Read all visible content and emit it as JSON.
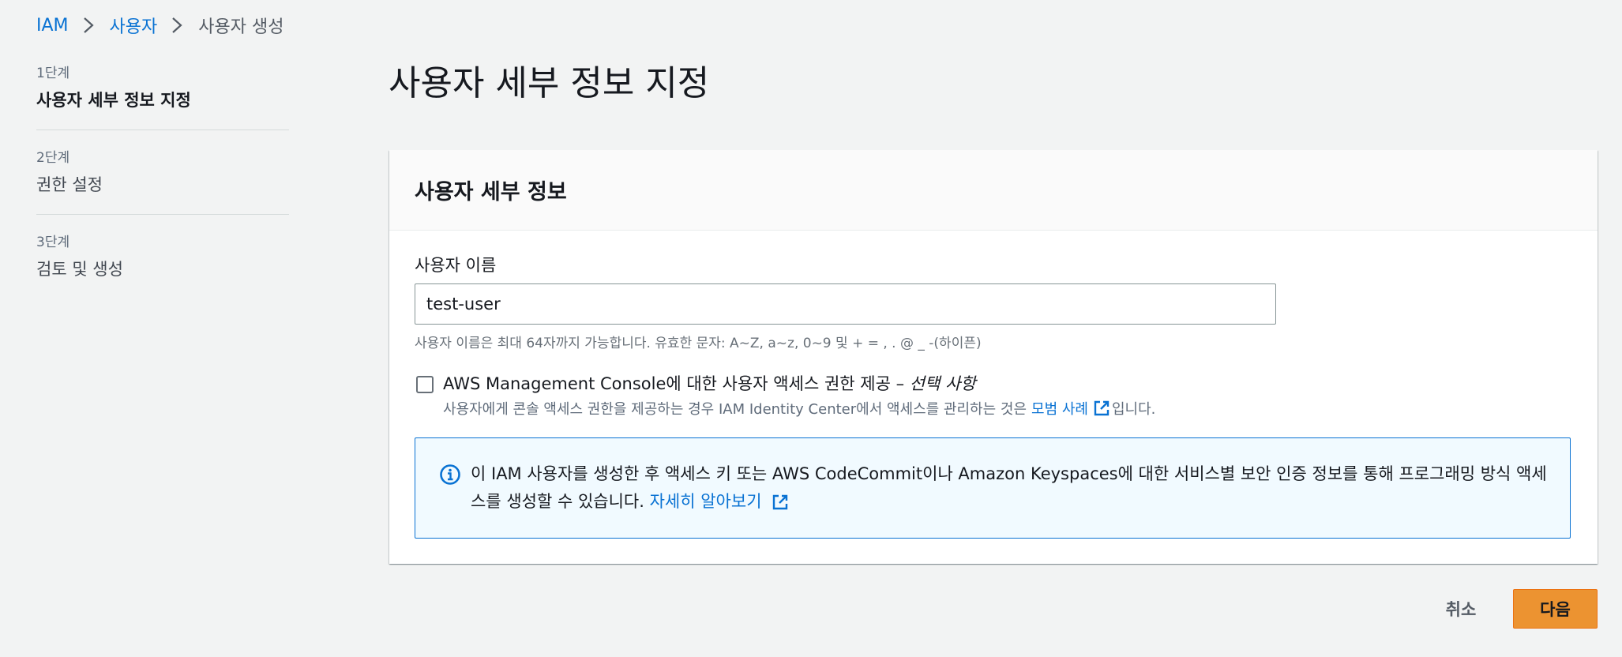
{
  "breadcrumb": {
    "items": [
      "IAM",
      "사용자"
    ],
    "current": "사용자 생성"
  },
  "steps": [
    {
      "number": "1단계",
      "title": "사용자 세부 정보 지정"
    },
    {
      "number": "2단계",
      "title": "권한 설정"
    },
    {
      "number": "3단계",
      "title": "검토 및 생성"
    }
  ],
  "page_title": "사용자 세부 정보 지정",
  "section": {
    "title": "사용자 세부 정보",
    "username": {
      "label": "사용자 이름",
      "value": "test-user",
      "hint": "사용자 이름은 최대 64자까지 가능합니다. 유효한 문자: A~Z, a~z, 0~9 및 + = , . @ _ -(하이픈)"
    },
    "console_access": {
      "label": "AWS Management Console에 대한 사용자 액세스 권한 제공 –",
      "optional": "선택 사항",
      "checked": false,
      "desc_before": "사용자에게 콘솔 액세스 권한을 제공하는 경우 IAM Identity Center에서 액세스를 관리하는 것은",
      "desc_link": "모범 사례",
      "desc_after": "입니다."
    },
    "info": {
      "text": "이 IAM 사용자를 생성한 후 액세스 키 또는 AWS CodeCommit이나 Amazon Keyspaces에 대한 서비스별 보안 인증 정보를 통해 프로그래밍 방식 액세스를 생성할 수 있습니다.",
      "link": "자세히 알아보기"
    }
  },
  "buttons": {
    "cancel": "취소",
    "next": "다음"
  },
  "colors": {
    "link": "#0972d3",
    "primary_button": "#ec9331",
    "info_background": "#f1faff",
    "page_background": "#f2f3f3"
  },
  "icons": [
    "chevron-right-icon",
    "external-link-icon",
    "info-icon"
  ]
}
